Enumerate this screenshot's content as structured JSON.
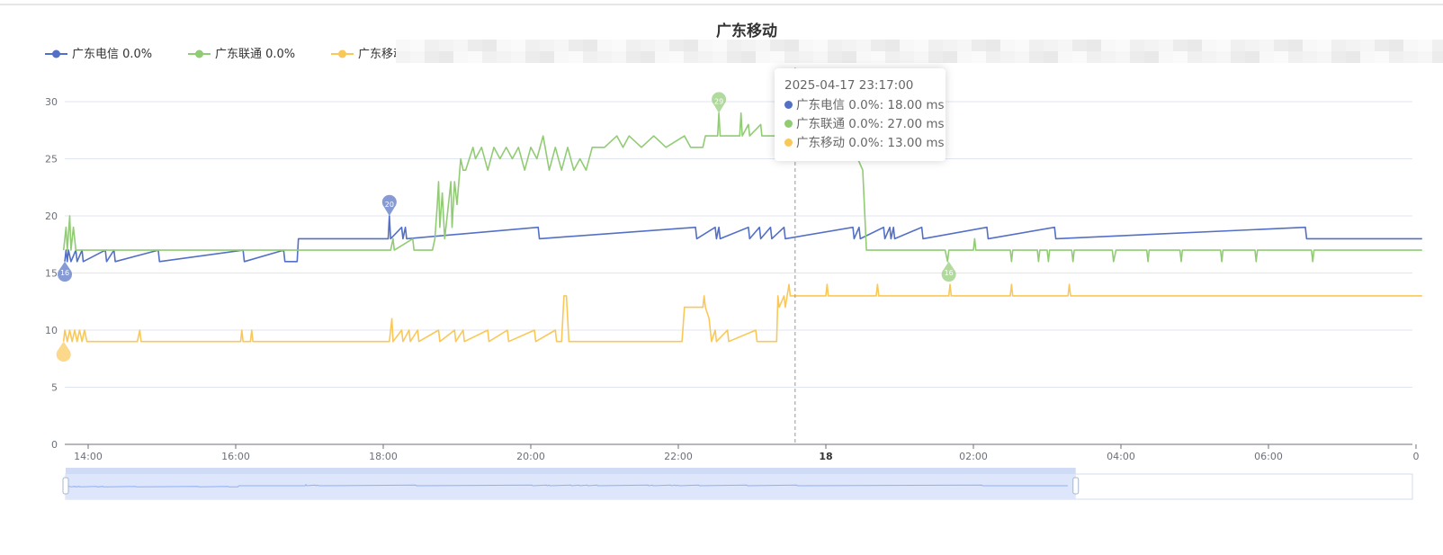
{
  "chart_data": {
    "type": "line",
    "title": "广东移动",
    "ylim": [
      0,
      30
    ],
    "y_ticks": [
      0,
      5,
      10,
      15,
      20,
      25,
      30
    ],
    "x_ticks": [
      {
        "label": "14:00",
        "t": 0,
        "bold": false
      },
      {
        "label": "16:00",
        "t": 120,
        "bold": false
      },
      {
        "label": "18:00",
        "t": 240,
        "bold": false
      },
      {
        "label": "20:00",
        "t": 360,
        "bold": false
      },
      {
        "label": "22:00",
        "t": 480,
        "bold": false
      },
      {
        "label": "18",
        "t": 600,
        "bold": true
      },
      {
        "label": "02:00",
        "t": 720,
        "bold": false
      },
      {
        "label": "04:00",
        "t": 840,
        "bold": false
      },
      {
        "label": "06:00",
        "t": 960,
        "bold": false
      },
      {
        "label": "0",
        "t": 1080,
        "bold": false
      }
    ],
    "x_domain_minutes_from_1400": [
      -20,
      1085
    ],
    "grid": true,
    "legend_position": "top-left",
    "series": [
      {
        "name": "广东电信 0.0%",
        "color": "#5470c6",
        "points": [
          [
            -19,
            16
          ],
          [
            -18,
            17
          ],
          [
            -17,
            16
          ],
          [
            -16,
            17
          ],
          [
            -14,
            16
          ],
          [
            -10,
            17
          ],
          [
            -9,
            16
          ],
          [
            -5,
            17
          ],
          [
            -4,
            16
          ],
          [
            14,
            17
          ],
          [
            15,
            16
          ],
          [
            21,
            17
          ],
          [
            22,
            16
          ],
          [
            57,
            17
          ],
          [
            58,
            16
          ],
          [
            126,
            17
          ],
          [
            127,
            16
          ],
          [
            159,
            17
          ],
          [
            160,
            16
          ],
          [
            170,
            16
          ],
          [
            171,
            18
          ],
          [
            244,
            18
          ],
          [
            245,
            20
          ],
          [
            246,
            18
          ],
          [
            255,
            19
          ],
          [
            256,
            18
          ],
          [
            258,
            19
          ],
          [
            259,
            18
          ],
          [
            366,
            19
          ],
          [
            367,
            18
          ],
          [
            494,
            19
          ],
          [
            495,
            18
          ],
          [
            510,
            19
          ],
          [
            511,
            18
          ],
          [
            513,
            19
          ],
          [
            514,
            18
          ],
          [
            537,
            19
          ],
          [
            538,
            18
          ],
          [
            546,
            19
          ],
          [
            547,
            18
          ],
          [
            555,
            19
          ],
          [
            556,
            18
          ],
          [
            566,
            19
          ],
          [
            567,
            18
          ],
          [
            622,
            19
          ],
          [
            623,
            18
          ],
          [
            627,
            19
          ],
          [
            628,
            18
          ],
          [
            647,
            19
          ],
          [
            648,
            18
          ],
          [
            652,
            19
          ],
          [
            653,
            18
          ],
          [
            655,
            19
          ],
          [
            656,
            18
          ],
          [
            678,
            19
          ],
          [
            679,
            18
          ],
          [
            731,
            19
          ],
          [
            732,
            18
          ],
          [
            786,
            19
          ],
          [
            787,
            18
          ],
          [
            990,
            19
          ],
          [
            991,
            18
          ],
          [
            1085,
            18
          ]
        ]
      },
      {
        "name": "广东联通 0.0%",
        "color": "#91cc75",
        "points": [
          [
            -20,
            17
          ],
          [
            -18,
            19
          ],
          [
            -17,
            17
          ],
          [
            -15,
            20
          ],
          [
            -14,
            17
          ],
          [
            -12,
            19
          ],
          [
            -10,
            17
          ],
          [
            171,
            17
          ],
          [
            246,
            17
          ],
          [
            248,
            18
          ],
          [
            249,
            17
          ],
          [
            264,
            18
          ],
          [
            265,
            17
          ],
          [
            280,
            17
          ],
          [
            282,
            18
          ],
          [
            284,
            21
          ],
          [
            285,
            23
          ],
          [
            286,
            19
          ],
          [
            288,
            22
          ],
          [
            290,
            18
          ],
          [
            292,
            20
          ],
          [
            295,
            23
          ],
          [
            296,
            19
          ],
          [
            298,
            23
          ],
          [
            300,
            21
          ],
          [
            303,
            25
          ],
          [
            305,
            24
          ],
          [
            307,
            24
          ],
          [
            310,
            25
          ],
          [
            313,
            26
          ],
          [
            315,
            25
          ],
          [
            320,
            26
          ],
          [
            325,
            24
          ],
          [
            330,
            26
          ],
          [
            335,
            25
          ],
          [
            340,
            26
          ],
          [
            345,
            25
          ],
          [
            350,
            26
          ],
          [
            355,
            24
          ],
          [
            360,
            26
          ],
          [
            365,
            25
          ],
          [
            370,
            27
          ],
          [
            375,
            24
          ],
          [
            380,
            26
          ],
          [
            385,
            24
          ],
          [
            390,
            26
          ],
          [
            395,
            24
          ],
          [
            400,
            25
          ],
          [
            405,
            24
          ],
          [
            410,
            26
          ],
          [
            420,
            26
          ],
          [
            430,
            27
          ],
          [
            435,
            26
          ],
          [
            440,
            27
          ],
          [
            450,
            26
          ],
          [
            460,
            27
          ],
          [
            470,
            26
          ],
          [
            485,
            27
          ],
          [
            490,
            26
          ],
          [
            500,
            26
          ],
          [
            502,
            27
          ],
          [
            505,
            27
          ],
          [
            512,
            27
          ],
          [
            513,
            29
          ],
          [
            514,
            27
          ],
          [
            530,
            27
          ],
          [
            531,
            29
          ],
          [
            532,
            27
          ],
          [
            537,
            28
          ],
          [
            538,
            27
          ],
          [
            547,
            28
          ],
          [
            548,
            27
          ],
          [
            560,
            27
          ],
          [
            563,
            28
          ],
          [
            565,
            27
          ],
          [
            600,
            27
          ],
          [
            605,
            29
          ],
          [
            606,
            27
          ],
          [
            620,
            27
          ],
          [
            622,
            25
          ],
          [
            624,
            26
          ],
          [
            626,
            25
          ],
          [
            630,
            24
          ],
          [
            633,
            17
          ],
          [
            697,
            17
          ],
          [
            699,
            16
          ],
          [
            700,
            17
          ],
          [
            720,
            17
          ],
          [
            721,
            18
          ],
          [
            722,
            17
          ],
          [
            750,
            17
          ],
          [
            751,
            16
          ],
          [
            752,
            17
          ],
          [
            772,
            17
          ],
          [
            773,
            16
          ],
          [
            774,
            17
          ],
          [
            780,
            17
          ],
          [
            781,
            16
          ],
          [
            782,
            17
          ],
          [
            800,
            17
          ],
          [
            801,
            16
          ],
          [
            802,
            17
          ],
          [
            833,
            17
          ],
          [
            834,
            16
          ],
          [
            836,
            17
          ],
          [
            861,
            17
          ],
          [
            862,
            16
          ],
          [
            863,
            17
          ],
          [
            888,
            17
          ],
          [
            889,
            16
          ],
          [
            890,
            17
          ],
          [
            921,
            17
          ],
          [
            922,
            16
          ],
          [
            923,
            17
          ],
          [
            949,
            17
          ],
          [
            950,
            16
          ],
          [
            951,
            17
          ],
          [
            995,
            17
          ],
          [
            996,
            16
          ],
          [
            997,
            17
          ],
          [
            1085,
            17
          ]
        ]
      },
      {
        "name": "广东移动 0.0%",
        "color": "#fac858",
        "points": [
          [
            -20,
            9
          ],
          [
            -19,
            10
          ],
          [
            -17,
            9
          ],
          [
            -15,
            10
          ],
          [
            -13,
            9
          ],
          [
            -11,
            10
          ],
          [
            -9,
            9
          ],
          [
            -7,
            10
          ],
          [
            -5,
            9
          ],
          [
            -3,
            10
          ],
          [
            -1,
            9
          ],
          [
            40,
            9
          ],
          [
            42,
            10
          ],
          [
            43,
            9
          ],
          [
            124,
            9
          ],
          [
            125,
            10
          ],
          [
            126,
            9
          ],
          [
            132,
            9
          ],
          [
            133,
            10
          ],
          [
            134,
            9
          ],
          [
            245,
            9
          ],
          [
            247,
            11
          ],
          [
            248,
            9
          ],
          [
            255,
            10
          ],
          [
            256,
            9
          ],
          [
            261,
            10
          ],
          [
            262,
            9
          ],
          [
            268,
            10
          ],
          [
            269,
            9
          ],
          [
            285,
            10
          ],
          [
            286,
            9
          ],
          [
            298,
            10
          ],
          [
            299,
            9
          ],
          [
            305,
            10
          ],
          [
            306,
            9
          ],
          [
            325,
            10
          ],
          [
            326,
            9
          ],
          [
            341,
            10
          ],
          [
            342,
            9
          ],
          [
            363,
            10
          ],
          [
            364,
            9
          ],
          [
            380,
            10
          ],
          [
            381,
            9
          ],
          [
            385,
            9
          ],
          [
            387,
            13
          ],
          [
            389,
            13
          ],
          [
            391,
            9
          ],
          [
            483,
            9
          ],
          [
            485,
            12
          ],
          [
            500,
            12
          ],
          [
            501,
            13
          ],
          [
            502,
            12
          ],
          [
            505,
            11
          ],
          [
            507,
            9
          ],
          [
            510,
            10
          ],
          [
            511,
            9
          ],
          [
            520,
            10
          ],
          [
            521,
            9
          ],
          [
            543,
            10
          ],
          [
            544,
            9
          ],
          [
            560,
            9
          ],
          [
            561,
            13
          ],
          [
            562,
            12
          ],
          [
            566,
            13
          ],
          [
            567,
            12
          ],
          [
            570,
            14
          ],
          [
            571,
            13
          ],
          [
            600,
            13
          ],
          [
            601,
            14
          ],
          [
            602,
            13
          ],
          [
            641,
            13
          ],
          [
            642,
            14
          ],
          [
            643,
            13
          ],
          [
            700,
            13
          ],
          [
            701,
            14
          ],
          [
            702,
            13
          ],
          [
            750,
            13
          ],
          [
            751,
            14
          ],
          [
            752,
            13
          ],
          [
            797,
            13
          ],
          [
            798,
            14
          ],
          [
            799,
            13
          ],
          [
            1085,
            13
          ]
        ]
      }
    ],
    "markers": [
      {
        "series": 0,
        "label": "20",
        "t": 245,
        "v": 20
      },
      {
        "series": 0,
        "label": "16",
        "t": -19,
        "v": 16
      },
      {
        "series": 1,
        "label": "29",
        "t": 513,
        "v": 29
      },
      {
        "series": 1,
        "label": "16",
        "t": 700,
        "v": 16
      },
      {
        "series": 2,
        "label": "",
        "t": -20,
        "v": 9
      }
    ],
    "crosshair_t": 575,
    "tooltip": {
      "time": "2025-04-17 23:17:00",
      "rows": [
        {
          "label": "广东电信 0.0%: 18.00 ms",
          "color": "#5470c6"
        },
        {
          "label": "广东联通 0.0%: 27.00 ms",
          "color": "#91cc75"
        },
        {
          "label": "广东移动 0.0%: 13.00 ms",
          "color": "#fac858"
        }
      ]
    },
    "data_zoom": {
      "start": 0,
      "end": 0.75
    }
  }
}
